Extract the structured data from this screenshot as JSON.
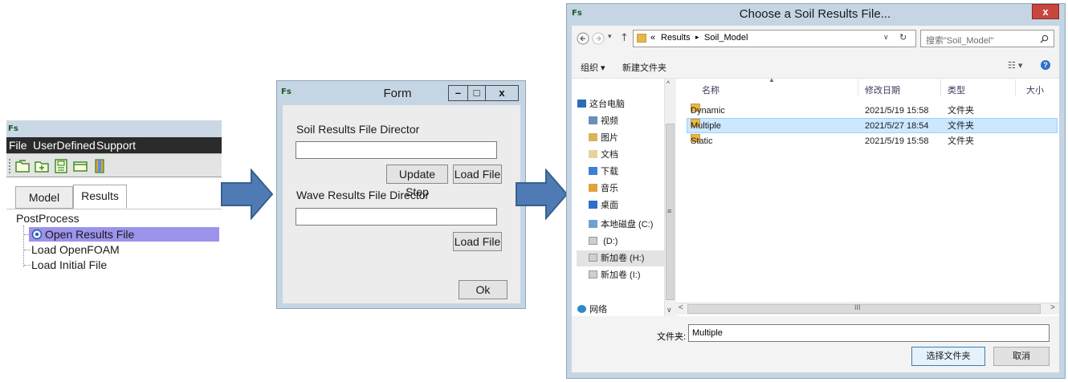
{
  "app": {
    "logo": "Fs",
    "menu": [
      "File",
      "UserDefined",
      "Support"
    ],
    "tabs": [
      "Model",
      "Results"
    ],
    "tree_root": "PostProcess",
    "tree_items": [
      "Open Results File",
      "Load OpenFOAM",
      "Load Initial File"
    ],
    "toolbar_icons": [
      "open-folder-icon",
      "new-folder-icon",
      "save-icon",
      "window-icon",
      "book-icon"
    ],
    "selection_color": "#9b93ec"
  },
  "form": {
    "logo": "Fs",
    "title": "Form",
    "minimize": "–",
    "maximize": "□",
    "close": "x",
    "soil_label": "Soil Results File Director",
    "soil_value": "",
    "update_step": "Update Step",
    "load_file_1": "Load File",
    "wave_label": "Wave Results File Director",
    "wave_value": "",
    "load_file_2": "Load File",
    "ok": "Ok"
  },
  "dialog": {
    "logo": "Fs",
    "title": "Choose a Soil Results File...",
    "close": "x",
    "address": [
      "«",
      "Results",
      "Soil_Model"
    ],
    "search_placeholder": "搜索\"Soil_Model\"",
    "organize": "组织 ▾",
    "new_folder": "新建文件夹",
    "nav_items": [
      {
        "label": "这台电脑",
        "icon": "pc-icon"
      },
      {
        "label": "视频",
        "icon": "video-icon"
      },
      {
        "label": "图片",
        "icon": "pictures-icon"
      },
      {
        "label": "文档",
        "icon": "documents-icon"
      },
      {
        "label": "下载",
        "icon": "downloads-icon"
      },
      {
        "label": "音乐",
        "icon": "music-icon"
      },
      {
        "label": "桌面",
        "icon": "desktop-icon"
      },
      {
        "label": "本地磁盘 (C:)",
        "icon": "disk-icon"
      },
      {
        "label": "(D:)",
        "icon": "drive-icon"
      },
      {
        "label": "新加卷 (H:)",
        "icon": "drive-icon"
      },
      {
        "label": "新加卷 (I:)",
        "icon": "drive-icon"
      },
      {
        "label": "网络",
        "icon": "network-icon"
      }
    ],
    "columns": [
      "名称",
      "修改日期",
      "类型",
      "大小"
    ],
    "rows": [
      {
        "name": "Dynamic",
        "date": "2021/5/19 15:58",
        "type": "文件夹"
      },
      {
        "name": "Multiple",
        "date": "2021/5/27 18:54",
        "type": "文件夹"
      },
      {
        "name": "Static",
        "date": "2021/5/19 15:58",
        "type": "文件夹"
      }
    ],
    "selected_row": 1,
    "folder_label": "文件夹:",
    "folder_value": "Multiple",
    "select_button": "选择文件夹",
    "cancel_button": "取消",
    "scroll_mark": "III"
  },
  "arrow_color": "#4f7ab3"
}
